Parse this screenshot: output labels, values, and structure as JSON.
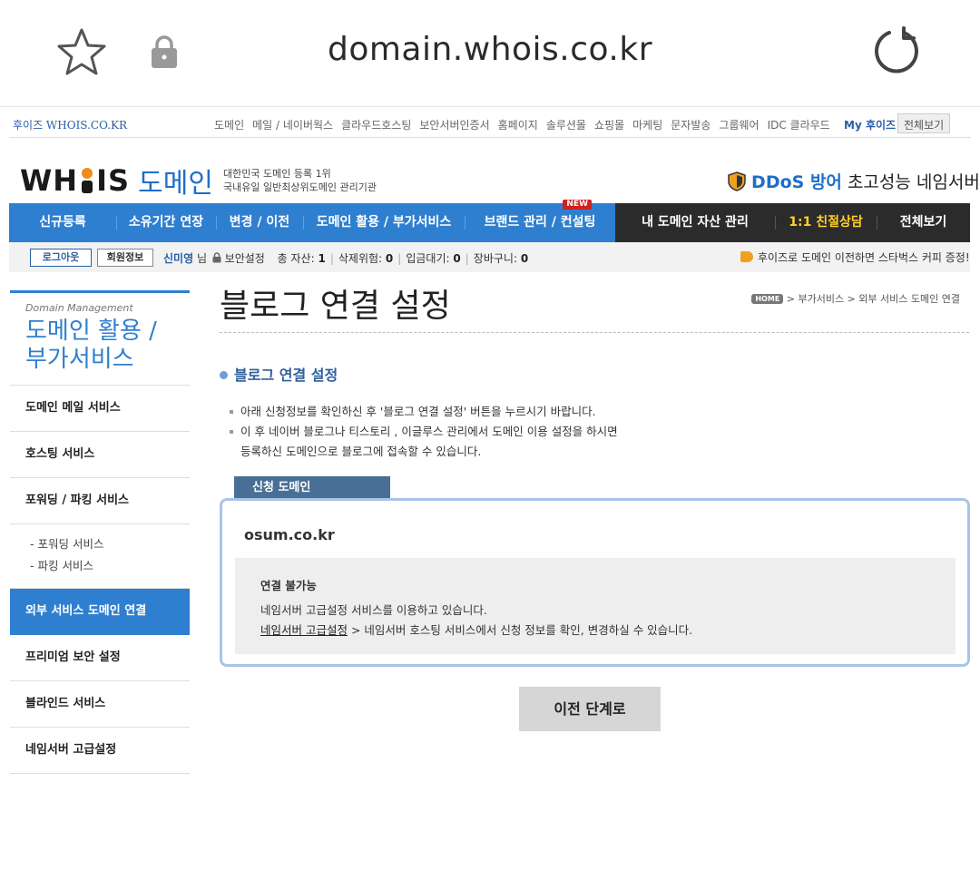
{
  "browser": {
    "url": "domain.whois.co.kr"
  },
  "util": {
    "brand": "후이즈 WHOIS.CO.KR",
    "menu": [
      "도메인",
      "메일 / 네이버웍스",
      "클라우드호스팅",
      "보안서버인증서",
      "홈페이지",
      "솔루션몰",
      "쇼핑몰",
      "마케팅",
      "문자발송",
      "그룹웨어",
      "IDC 클라우드"
    ],
    "my_whois": "My 후이즈",
    "all_view": "전체보기"
  },
  "logo": {
    "wh": "WH",
    "is": "IS",
    "domain": "도메인",
    "tag_line1": "대한민국 도메인 등록 1위",
    "tag_line2": "국내유일 일반최상위도메인 관리기관"
  },
  "ddos": {
    "bold": "DDoS 방어",
    "rest": "초고성능 네임서버"
  },
  "gnb": {
    "blue": [
      "신규등록",
      "소유기간 연장",
      "변경 / 이전",
      "도메인 활용 / 부가서비스",
      "브랜드 관리 / 컨설팅"
    ],
    "new_badge": "NEW",
    "dark": [
      "내 도메인 자산 관리",
      "1:1 친절상담",
      "전체보기"
    ]
  },
  "loginbar": {
    "logout": "로그아웃",
    "member_info": "회원정보",
    "user_name": "신미영",
    "user_suffix": "님",
    "security": "보안설정",
    "assets_label": "총 자산:",
    "assets_value": "1",
    "delete_label": "삭제위험:",
    "delete_value": "0",
    "deposit_label": "입금대기:",
    "deposit_value": "0",
    "cart_label": "장바구니:",
    "cart_value": "0",
    "promo": "후이즈로 도메인 이전하면 스타벅스 커피 증정!"
  },
  "sidebar": {
    "en_title": "Domain Management",
    "ko_title_line1": "도메인 활용 /",
    "ko_title_line2": "부가서비스",
    "items": [
      {
        "label": "도메인 메일 서비스"
      },
      {
        "label": "호스팅 서비스"
      },
      {
        "label": "포워딩 / 파킹 서비스"
      },
      {
        "label": "외부 서비스 도메인 연결"
      },
      {
        "label": "프리미엄 보안 설정"
      },
      {
        "label": "블라인드 서비스"
      },
      {
        "label": "네임서버 고급설정"
      }
    ],
    "subs": [
      "- 포워딩 서비스",
      "- 파킹 서비스"
    ]
  },
  "main": {
    "page_title": "블로그 연결 설정",
    "breadcrumb_home": "HOME",
    "breadcrumb": "> 부가서비스 > 외부 서비스 도메인 연결",
    "section_title": "블로그 연결 설정",
    "note1": "아래 신청정보를 확인하신 후 '블로그 연결 설정' 버튼을 누르시기 바랍니다.",
    "note2_line1": "이 후 네이버 블로그나 티스토리 , 이글루스 관리에서 도메인 이용 설정을 하시면",
    "note2_line2": "등록하신 도메인으로 블로그에 접속할 수 있습니다.",
    "tab_label": "신청 도메인",
    "domain_name": "osum.co.kr",
    "status": "연결 불가능",
    "status_desc": "네임서버 고급설정 서비스를 이용하고 있습니다.",
    "status_link": "네임서버 고급설정",
    "status_desc2": " > 네임서버 호스팅 서비스에서 신청 정보를 확인, 변경하실 수 있습니다.",
    "prev_button": "이전 단계로"
  },
  "colors": {
    "accent_blue": "#2f7fd0",
    "dark_nav": "#2b2b2b",
    "highlight_yellow": "#ffd02a",
    "box_border": "#a8c4e6"
  }
}
